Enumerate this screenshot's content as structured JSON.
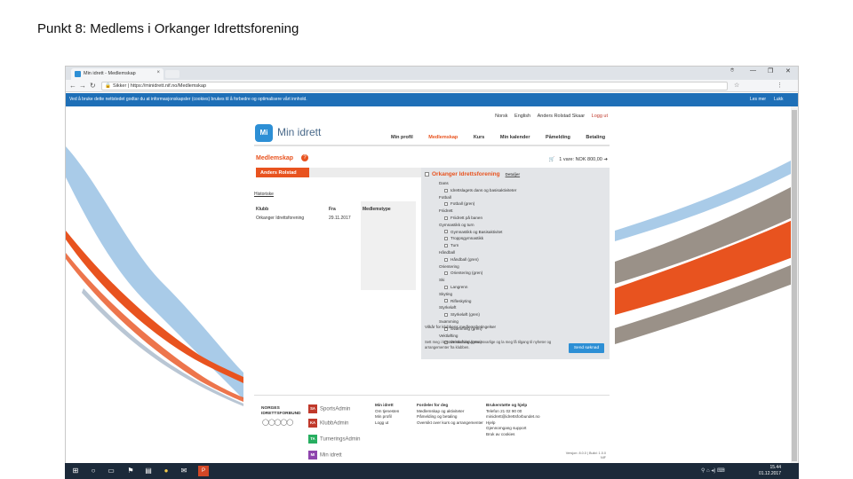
{
  "slide": {
    "title": "Punkt 8: Medlems i Orkanger Idrettsforening"
  },
  "browser": {
    "tab_label": "Min idrett - Medlemskap",
    "tab_close": "×",
    "window_controls": [
      "⌾",
      "—",
      "❐",
      "✕"
    ],
    "address_prefix": "Sikker",
    "address_url": "https://minidrett.nif.no/Medlemskap",
    "address_full": "Sikker | https://minidrett.nif.no/Medlemskap"
  },
  "cookiebar": {
    "text": "Ved å bruke dette nettstedet godtar du at informasjonskapsler (cookies) brukes til å forbedre og optimalisere vårt innhold.",
    "more": "Les mer",
    "close": "Lukk"
  },
  "header": {
    "toplinks": [
      "Norsk",
      "English",
      "Anders Rolstad Skaar",
      "Logg ut"
    ],
    "logo_mark": "Mi",
    "logo_text": "Min idrett",
    "nav": [
      {
        "label": "Min profil",
        "active": false
      },
      {
        "label": "Medlemskap",
        "active": true
      },
      {
        "label": "Kurs",
        "active": false
      },
      {
        "label": "Min kalender",
        "active": false
      },
      {
        "label": "Påmelding",
        "active": false
      },
      {
        "label": "Betaling",
        "active": false
      }
    ]
  },
  "membership": {
    "title": "Medlemskap",
    "help": "?",
    "cart_text": "1 vare: NOK 800,00",
    "member_button": "Anders Rolstad",
    "history_link": "Historiske",
    "columns": [
      "Klubb",
      "Fra",
      "Medlemstype"
    ],
    "rows": [
      {
        "club": "Orkanger Idrettsforening",
        "from": "29.11.2017",
        "type": ""
      }
    ]
  },
  "club_panel": {
    "title": "Orkanger Idrettsforening",
    "details": "Detaljer",
    "items": [
      {
        "label": "Dans",
        "type": "header"
      },
      {
        "label": "Idrettslagets dans og basisaktiviteter",
        "type": "check"
      },
      {
        "label": "Fotball",
        "type": "header"
      },
      {
        "label": "Fotball (gren)",
        "type": "check"
      },
      {
        "label": "Friidrett",
        "type": "header"
      },
      {
        "label": "Friidrett på banen",
        "type": "check"
      },
      {
        "label": "Gymnastikk og turn",
        "type": "header"
      },
      {
        "label": "Gymnastikk og Basisaktivitet",
        "type": "check"
      },
      {
        "label": "Troppsgymnastikk",
        "type": "check"
      },
      {
        "label": "Turn",
        "type": "check"
      },
      {
        "label": "Håndball",
        "type": "header"
      },
      {
        "label": "Håndball (gren)",
        "type": "check"
      },
      {
        "label": "Orientering",
        "type": "header"
      },
      {
        "label": "Orientering (gren)",
        "type": "check"
      },
      {
        "label": "Ski",
        "type": "header"
      },
      {
        "label": "Langrenn",
        "type": "check"
      },
      {
        "label": "Skyting",
        "type": "header"
      },
      {
        "label": "Rifleskyting",
        "type": "check"
      },
      {
        "label": "Styrkeløft",
        "type": "header"
      },
      {
        "label": "Styrkeløft (gren)",
        "type": "check"
      },
      {
        "label": "Svømming",
        "type": "header"
      },
      {
        "label": "Svømming (gren)",
        "type": "check"
      },
      {
        "label": "Vektløfting",
        "type": "header"
      },
      {
        "label": "Vektløfting (gren)",
        "type": "check"
      }
    ],
    "terms": "Vilkår for klubbens medlemsbetingelser",
    "consent": "Sett meg i kontakt med aktivitetsansvarlige og la meg få tilgang til nyheter og arrangementer fra klubben.",
    "send_button": "Send søknad"
  },
  "footer": {
    "nif_line1": "NORGES",
    "nif_line2": "IDRETTSFORBUND",
    "rings": "◯◯◯◯◯",
    "brands": [
      {
        "code": "SA",
        "name": "SportsAdmin",
        "color": "#c0392b"
      },
      {
        "code": "KA",
        "name": "KlubbAdmin",
        "color": "#c0392b"
      },
      {
        "code": "TA",
        "name": "TurneringsAdmin",
        "color": "#27ae60"
      },
      {
        "code": "MI",
        "name": "Min idrett",
        "color": "#8e44ad"
      }
    ],
    "col1": {
      "head": "Min idrett",
      "lines": [
        "Om tjenesten",
        "Min profil",
        "Logg ut"
      ]
    },
    "col2": {
      "head": "Fordeler for deg",
      "lines": [
        "Medlemskap og aktiviteter",
        "Påmelding og betaling",
        "Oversikt over kurs og arrangementer"
      ]
    },
    "col3": {
      "head": "Brukerstøtte og hjelp",
      "lines": [
        "Telefon 21 02 90 00",
        "minidrett@idrettsforbundet.no",
        "Hjelp",
        "Gjennomgang support",
        "Bruk av cookies"
      ]
    },
    "version_line1": "Versjon: 8.0.0 | Build: 1.0.0",
    "version_line2": "NIF"
  },
  "taskbar": {
    "icons": [
      "⊞",
      "○",
      "▭",
      "⚑",
      "▤",
      "●",
      "✉",
      "P"
    ],
    "sys": "⚲  ⌂  ◂)  ⌨",
    "time": "15.44",
    "date": "01.12.2017"
  }
}
